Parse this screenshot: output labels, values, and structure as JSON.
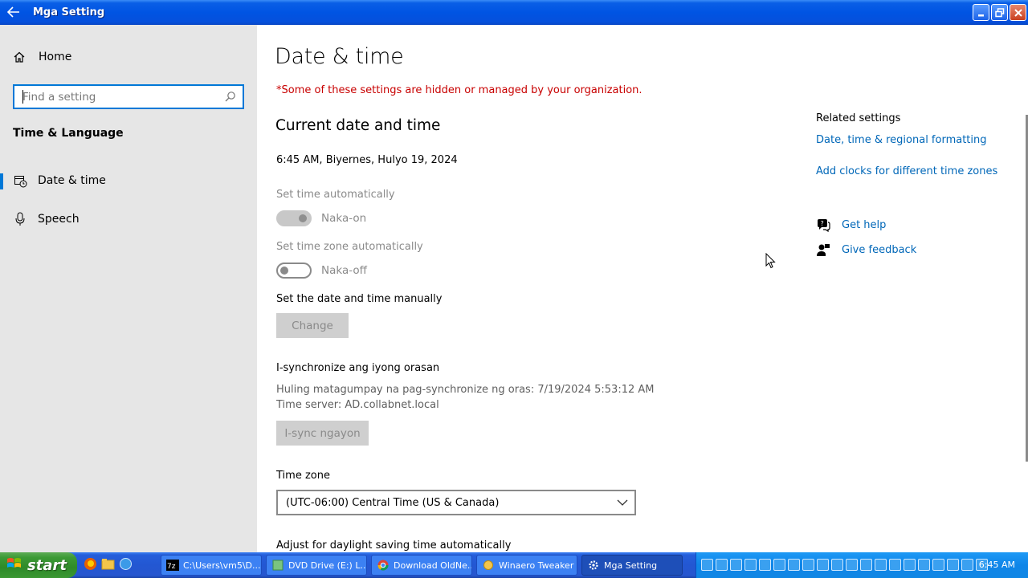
{
  "window": {
    "title": "Mga Setting",
    "accent": "#0078d7"
  },
  "sidebar": {
    "home_label": "Home",
    "search_placeholder": "Find a setting",
    "section_title": "Time & Language",
    "items": [
      {
        "label": "Date & time",
        "icon": "calendar-clock-icon",
        "active": true
      },
      {
        "label": "Speech",
        "icon": "microphone-icon",
        "active": false
      }
    ]
  },
  "main": {
    "page_title": "Date & time",
    "managed_notice": "*Some of these settings are hidden or managed by your organization.",
    "current_header": "Current date and time",
    "current_datetime": "6:45 AM, Biyernes, Hulyo 19, 2024",
    "set_time_auto": {
      "label": "Set time automatically",
      "state": "Naka-on"
    },
    "set_tz_auto": {
      "label": "Set time zone automatically",
      "state": "Naka-off"
    },
    "manual_label": "Set the date and time manually",
    "change_button": "Change",
    "sync_header": "I-synchronize ang iyong orasan",
    "sync_last": "Huling matagumpay na pag-synchronize ng oras: 7/19/2024 5:53:12 AM",
    "sync_server": "Time server: AD.collabnet.local",
    "sync_button": "I-sync ngayon",
    "timezone_label": "Time zone",
    "timezone_value": "(UTC-06:00) Central Time (US & Canada)",
    "dst_label": "Adjust for daylight saving time automatically"
  },
  "related": {
    "title": "Related settings",
    "links": [
      "Date, time & regional formatting",
      "Add clocks for different time zones"
    ],
    "get_help": "Get help",
    "give_feedback": "Give feedback",
    "link_color": "#0067b8"
  },
  "taskbar": {
    "start_label": "start",
    "tasks": [
      {
        "label": "C:\\Users\\vm5\\D...",
        "icon": "7zip-icon"
      },
      {
        "label": "DVD Drive (E:) L...",
        "icon": "dvd-drive-icon"
      },
      {
        "label": "Download OldNe...",
        "icon": "chrome-icon"
      },
      {
        "label": "Winaero Tweaker",
        "icon": "winaero-icon"
      },
      {
        "label": "Mga Setting",
        "icon": "gear-icon"
      }
    ],
    "clock": "6:45 AM"
  }
}
